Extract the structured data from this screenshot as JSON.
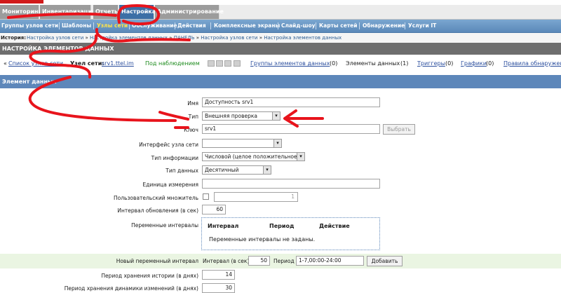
{
  "menu": {
    "items": [
      "Мониторинг",
      "Инвентаризация",
      "Отчеты",
      "Настройка",
      "Администрирование"
    ],
    "active": 3
  },
  "submenu": {
    "items": [
      "Группы узлов сети",
      "Шаблоны",
      "Узлы сети",
      "Обслуживание",
      "Действия",
      "Комплексные экраны",
      "Слайд-шоу",
      "Карты сетей",
      "Обнаружение",
      "Услуги IT"
    ],
    "active": 2
  },
  "history": {
    "label": "История:",
    "items": [
      "Настройка узлов сети",
      "Настройка элементов данных",
      "ПАНЕЛЬ",
      "Настройка узлов сети",
      "Настройка элементов данных"
    ]
  },
  "page_title": "НАСТРОЙКА ЭЛЕМЕНТОВ ДАННЫХ",
  "hostbar": {
    "back_prefix": "«",
    "back_link": "Список узлов сети",
    "host_label": "Узел сети:",
    "host_name": "srv1.ttel.im",
    "status": "Под наблюдением",
    "app_groups": "Группы элементов данных",
    "app_groups_count": "(0)",
    "items": "Элементы данных",
    "items_count": "(1)",
    "triggers": "Триггеры",
    "triggers_count": "(0)",
    "graphs": "Графики",
    "graphs_count": "(0)",
    "discovery": "Правила обнаружен"
  },
  "section_title": "Элемент данных",
  "form": {
    "name_label": "Имя",
    "name_value": "Доступность srv1",
    "type_label": "Тип",
    "type_value": "Внешняя проверка",
    "key_label": "Ключ",
    "key_value": "srv1",
    "select_button": "Выбрать",
    "interface_label": "Интерфейс узла сети",
    "interface_value": "",
    "info_type_label": "Тип информации",
    "info_type_value": "Числовой (целое положительное)",
    "data_type_label": "Тип данных",
    "data_type_value": "Десятичный",
    "unit_label": "Единица измерения",
    "unit_value": "",
    "multiplier_label": "Пользовательский множитель",
    "multiplier_value": "1",
    "update_label": "Интервал обновления (в сек)",
    "update_value": "60",
    "flex_label": "Переменные интервалы",
    "flex_headers": [
      "Интервал",
      "Период",
      "Действие"
    ],
    "flex_empty": "Переменные интервалы не заданы.",
    "new_flex_label": "Новый переменный интервал",
    "new_flex_interval_label": "Интервал (в сек)",
    "new_flex_interval_value": "50",
    "new_flex_period_label": "Период",
    "new_flex_period_value": "1-7,00:00-24:00",
    "add_button": "Добавить",
    "history_label": "Период хранения истории (в днях)",
    "history_value": "14",
    "trends_label": "Период хранения динамики изменений (в днях)",
    "trends_value": "30"
  },
  "colors": {
    "menu_active": "#3c6fa6",
    "submenu_active": "#ffe24a",
    "annotation": "#e8141c",
    "status_ok": "#1b8a1b"
  }
}
